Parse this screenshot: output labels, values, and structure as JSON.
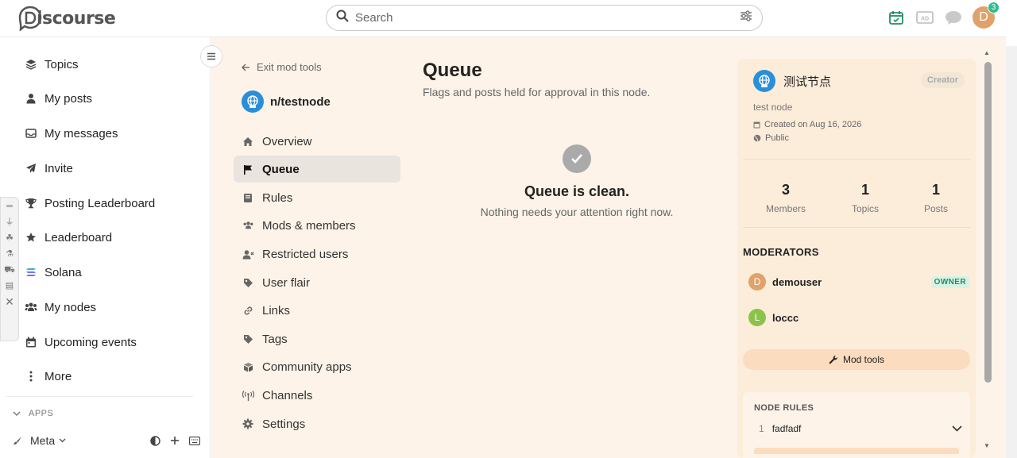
{
  "header": {
    "logo_text": "iscourse",
    "search_placeholder": "Search",
    "notification_count": "3",
    "avatar_letter": "D"
  },
  "sidebar": {
    "items": [
      {
        "label": "Topics",
        "icon": "layers-icon"
      },
      {
        "label": "My posts",
        "icon": "user-icon"
      },
      {
        "label": "My messages",
        "icon": "inbox-icon"
      },
      {
        "label": "Invite",
        "icon": "paper-plane-icon"
      },
      {
        "label": "Posting Leaderboard",
        "icon": "trophy-icon"
      },
      {
        "label": "Leaderboard",
        "icon": "star-icon"
      },
      {
        "label": "Solana",
        "icon": "solana-icon"
      },
      {
        "label": "My nodes",
        "icon": "users-icon"
      },
      {
        "label": "Upcoming events",
        "icon": "calendar-icon"
      },
      {
        "label": "More",
        "icon": "ellipsis-icon"
      }
    ],
    "apps_label": "APPS",
    "footer_label": "Meta"
  },
  "modnav": {
    "exit_label": "Exit mod tools",
    "node_name": "n/testnode",
    "items": [
      {
        "label": "Overview"
      },
      {
        "label": "Queue"
      },
      {
        "label": "Rules"
      },
      {
        "label": "Mods & members"
      },
      {
        "label": "Restricted users"
      },
      {
        "label": "User flair"
      },
      {
        "label": "Links"
      },
      {
        "label": "Tags"
      },
      {
        "label": "Community apps"
      },
      {
        "label": "Channels"
      },
      {
        "label": "Settings"
      }
    ],
    "active_index": 1
  },
  "queue": {
    "title": "Queue",
    "subtitle": "Flags and posts held for approval in this node.",
    "empty_title": "Queue is clean.",
    "empty_text": "Nothing needs your attention right now."
  },
  "node_card": {
    "name": "测试节点",
    "role_badge": "Creator",
    "description": "test node",
    "created": "Created on Aug 16, 2026",
    "visibility": "Public",
    "stats": [
      {
        "value": "3",
        "label": "Members"
      },
      {
        "value": "1",
        "label": "Topics"
      },
      {
        "value": "1",
        "label": "Posts"
      }
    ],
    "moderators_heading": "MODERATORS",
    "moderators": [
      {
        "letter": "D",
        "name": "demouser",
        "color": "#e0a26b"
      },
      {
        "letter": "L",
        "name": "loccc",
        "color": "#8bc34a"
      }
    ],
    "owner_badge": "OWNER",
    "mod_tools_label": "Mod tools",
    "rules_heading": "NODE RULES",
    "rules": [
      {
        "num": "1",
        "text": "fadfadf"
      }
    ]
  },
  "colors": {
    "main_bg": "#fdf3e8",
    "card_bg": "#fcecda",
    "accent_green": "#2bbd8e",
    "node_blue": "#2a8fd8"
  }
}
